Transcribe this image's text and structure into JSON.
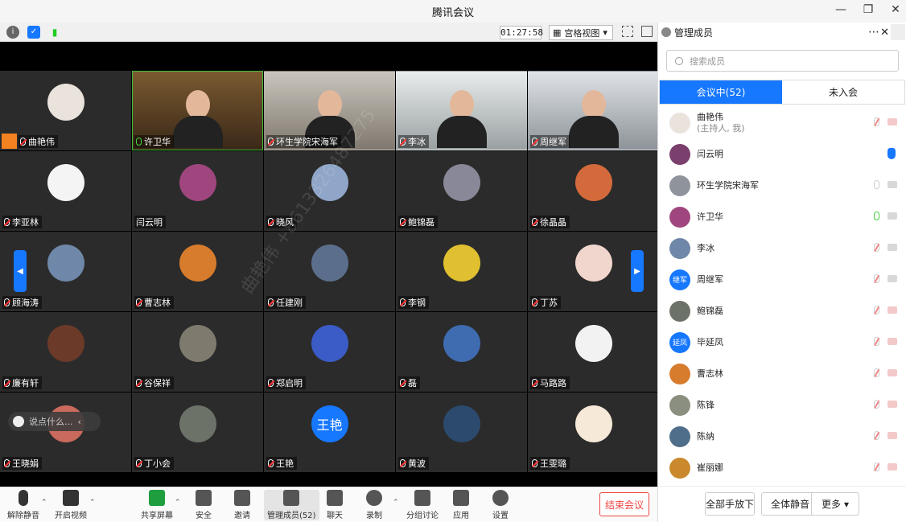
{
  "window": {
    "title": "腾讯会议"
  },
  "toolbar": {
    "timer": "01:27:58",
    "view_label": "宫格视图"
  },
  "watermark": "曲艳伟 +8613326487275",
  "tiles": [
    {
      "name": "曲艳伟",
      "mic": "off",
      "host": true
    },
    {
      "name": "许卫华",
      "mic": "on",
      "active": true,
      "video": "v2"
    },
    {
      "name": "环生学院宋海军",
      "mic": "off",
      "video": "v3"
    },
    {
      "name": "李冰",
      "mic": "off",
      "video": "v4"
    },
    {
      "name": "周继军",
      "mic": "off",
      "video": "v5"
    },
    {
      "name": "李亚林",
      "mic": "off"
    },
    {
      "name": "闫云明",
      "mic": "none"
    },
    {
      "name": "晓风",
      "mic": "off"
    },
    {
      "name": "鲍锦磊",
      "mic": "off"
    },
    {
      "name": "徐晶晶",
      "mic": "off"
    },
    {
      "name": "顾海涛",
      "mic": "off"
    },
    {
      "name": "曹志林",
      "mic": "off"
    },
    {
      "name": "任建刚",
      "mic": "off"
    },
    {
      "name": "李钢",
      "mic": "off"
    },
    {
      "name": "丁苏",
      "mic": "off"
    },
    {
      "name": "廉有轩",
      "mic": "off"
    },
    {
      "name": "谷保祥",
      "mic": "off"
    },
    {
      "name": "郑启明",
      "mic": "off"
    },
    {
      "name": "磊",
      "mic": "off"
    },
    {
      "name": "马路路",
      "mic": "off"
    },
    {
      "name": "王晓娟",
      "mic": "off"
    },
    {
      "name": "丁小会",
      "mic": "off"
    },
    {
      "name": "王艳",
      "mic": "off",
      "avatar_text": "王艳"
    },
    {
      "name": "黄波",
      "mic": "off"
    },
    {
      "name": "王雯璐",
      "mic": "off"
    }
  ],
  "chat": {
    "placeholder": "说点什么..."
  },
  "bottom": {
    "unmute": "解除静音",
    "video": "开启视频",
    "share": "共享屏幕",
    "security": "安全",
    "invite": "邀请",
    "members": "管理成员(52)",
    "chat": "聊天",
    "record": "录制",
    "breakout": "分组讨论",
    "apps": "应用",
    "settings": "设置",
    "end": "结束会议"
  },
  "panel": {
    "title": "管理成员",
    "search_placeholder": "搜索成员",
    "tab_in": "会议中(52)",
    "tab_out": "未入会",
    "members": [
      {
        "name": "曲艳伟",
        "role": "(主持人, 我)",
        "mic": "off",
        "cam": "off",
        "color": "#e9e3dc"
      },
      {
        "name": "闫云明",
        "hand": true,
        "color": "#7a3f6c"
      },
      {
        "name": "环生学院宋海军",
        "mic": "idle",
        "cam": "idle",
        "color": "#8f949c"
      },
      {
        "name": "许卫华",
        "mic": "on",
        "cam": "idle",
        "color": "#a0467e"
      },
      {
        "name": "李冰",
        "mic": "off",
        "cam": "idle",
        "color": "#6f87a8"
      },
      {
        "name": "周继军",
        "mic": "off",
        "cam": "idle",
        "avatar_text": "继军"
      },
      {
        "name": "鲍锦磊",
        "mic": "off",
        "cam": "off",
        "color": "#6d7268"
      },
      {
        "name": "毕延凤",
        "mic": "off",
        "cam": "off",
        "avatar_text": "延凤"
      },
      {
        "name": "曹志林",
        "mic": "off",
        "cam": "off",
        "color": "#d77b2c"
      },
      {
        "name": "陈锋",
        "mic": "off",
        "cam": "off",
        "color": "#8a8f80"
      },
      {
        "name": "陈纳",
        "mic": "off",
        "cam": "off",
        "color": "#4f6e8a"
      },
      {
        "name": "崔丽娜",
        "mic": "off",
        "cam": "off",
        "color": "#c9892c"
      }
    ],
    "footer": {
      "raise_all": "全部手放下",
      "mute_all": "全体静音",
      "more": "更多"
    }
  }
}
